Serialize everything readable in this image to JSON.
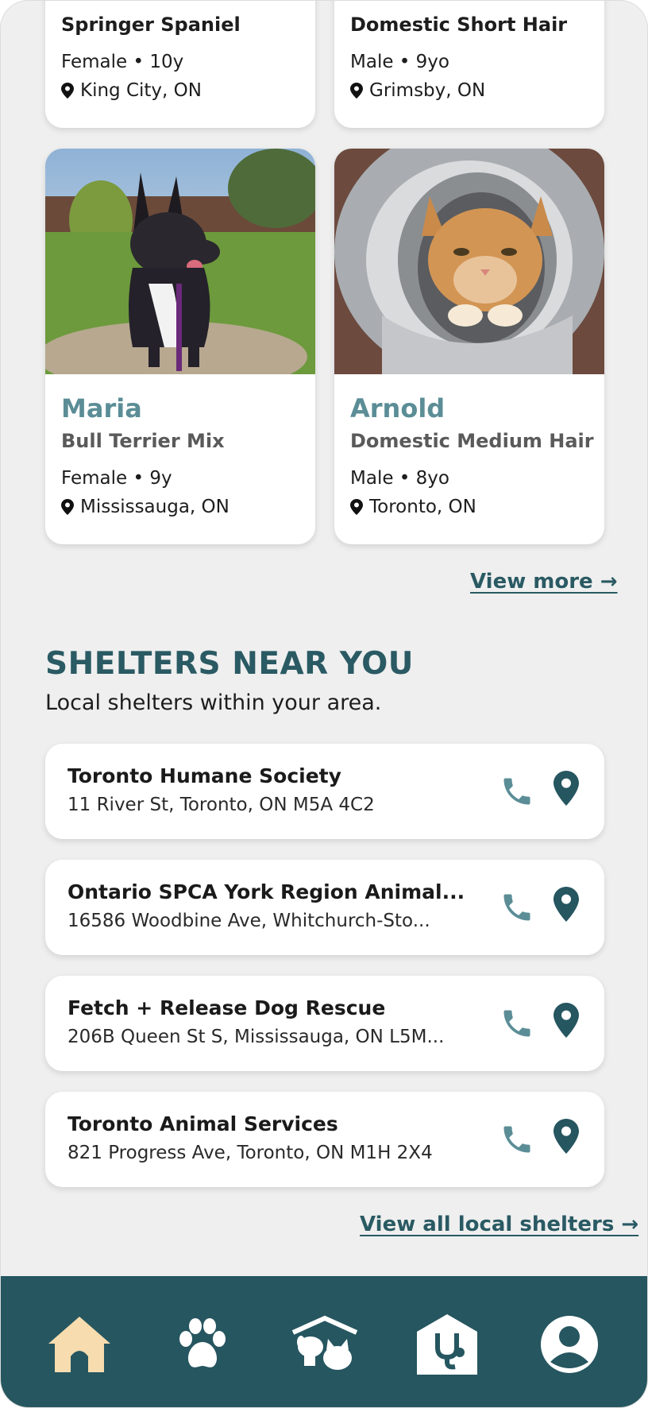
{
  "colors": {
    "accent": "#2a5a63",
    "pet_name": "#5b8d96",
    "nav_bg": "#265660",
    "nav_active": "#f6dcae",
    "nav_icon": "#ffffff",
    "background": "#efefef"
  },
  "top_cards": [
    {
      "breed": "Springer Spaniel",
      "meta": "Female • 10y",
      "location": "King City, ON"
    },
    {
      "breed": "Domestic Short Hair",
      "meta": "Male • 9yo",
      "location": "Grimsby, ON"
    }
  ],
  "pet_cards": [
    {
      "name": "Maria",
      "breed": "Bull Terrier Mix",
      "meta": "Female • 9y",
      "location": "Mississauga, ON",
      "photo_icon": "dog-photo"
    },
    {
      "name": "Arnold",
      "breed": "Domestic Medium Hair",
      "meta": "Male • 8yo",
      "location": "Toronto, ON",
      "photo_icon": "cat-photo"
    }
  ],
  "view_more": "View more →",
  "shelters_section": {
    "title": "SHELTERS NEAR YOU",
    "subtitle": "Local shelters within your area.",
    "items": [
      {
        "name": "Toronto Humane Society",
        "address": "11 River St, Toronto, ON M5A 4C2"
      },
      {
        "name": "Ontario SPCA York Region Animal...",
        "address": "16586 Woodbine Ave, Whitchurch-Sto..."
      },
      {
        "name": "Fetch + Release Dog Rescue",
        "address": "206B Queen St S, Mississauga, ON L5M..."
      },
      {
        "name": "Toronto Animal Services",
        "address": "821 Progress Ave, Toronto, ON M1H 2X4"
      }
    ],
    "view_all": "View all local shelters →"
  },
  "bottom_nav": {
    "items": [
      {
        "icon": "home-icon",
        "active": true
      },
      {
        "icon": "paw-icon",
        "active": false
      },
      {
        "icon": "shelter-icon",
        "active": false
      },
      {
        "icon": "vet-icon",
        "active": false
      },
      {
        "icon": "profile-icon",
        "active": false
      }
    ]
  }
}
